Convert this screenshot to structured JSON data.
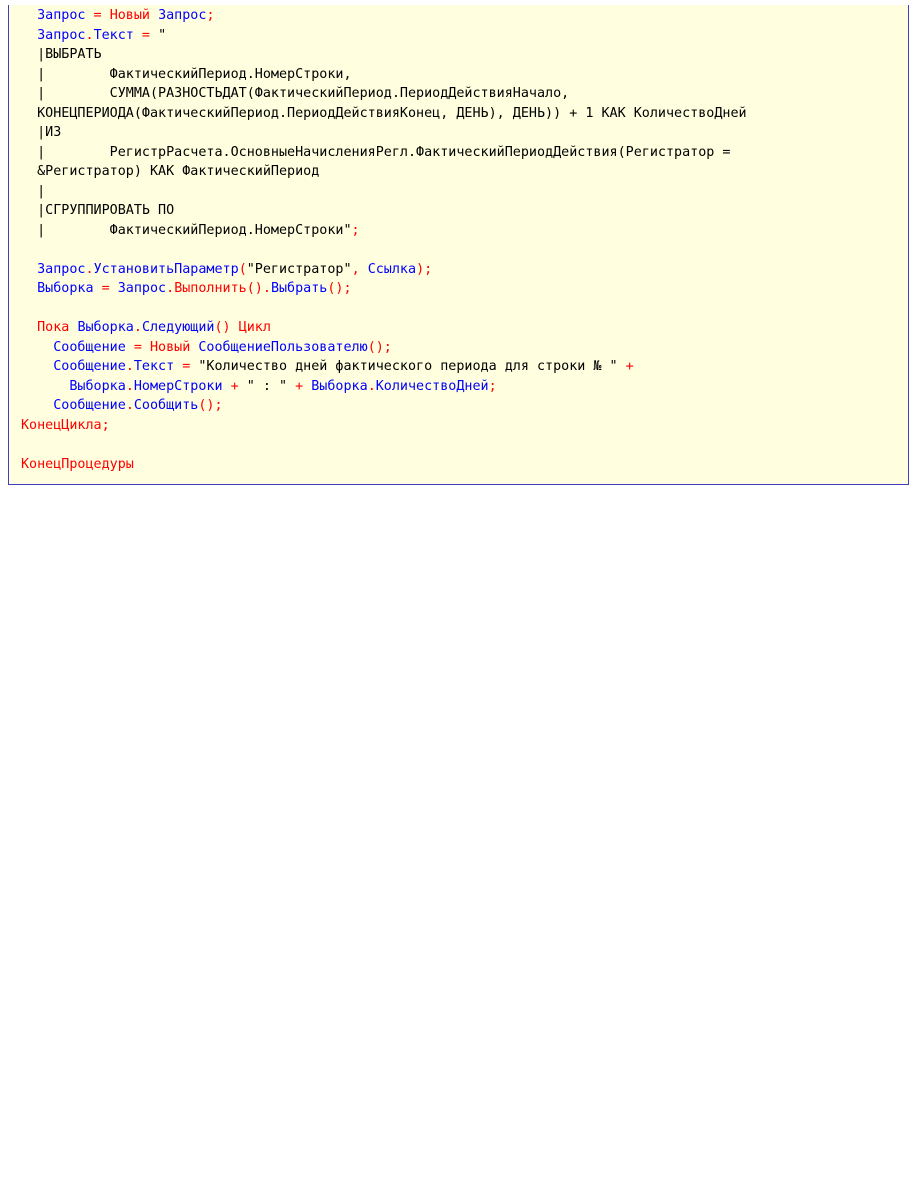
{
  "colors": {
    "background": "#ffffe0",
    "border": "#3f3fbf",
    "identifier": "#0000ff",
    "keyword": "#ff0000",
    "string": "#000000"
  },
  "code": {
    "lines": [
      [
        [
          "  ",
          "s"
        ],
        [
          "Запрос",
          "id"
        ],
        [
          " = ",
          "op"
        ],
        [
          "Новый",
          "kw"
        ],
        [
          " ",
          "s"
        ],
        [
          "Запрос",
          "id"
        ],
        [
          ";",
          "op"
        ]
      ],
      [
        [
          "  ",
          "s"
        ],
        [
          "Запрос",
          "id"
        ],
        [
          ".",
          "op"
        ],
        [
          "Текст",
          "id"
        ],
        [
          " = ",
          "op"
        ],
        [
          "\"",
          "str"
        ]
      ],
      [
        [
          "  |ВЫБРАТЬ",
          "str"
        ]
      ],
      [
        [
          "  |        ФактическийПериод.НомерСтроки,",
          "str"
        ]
      ],
      [
        [
          "  |        СУММА(РАЗНОСТЬДАТ(ФактическийПериод.ПериодДействияНачало,",
          "str"
        ]
      ],
      [
        [
          "  КОНЕЦПЕРИОДА(ФактическийПериод.ПериодДействияКонец, ДЕНЬ), ДЕНЬ)) + 1 КАК КоличествоДней",
          "str"
        ]
      ],
      [
        [
          "  |ИЗ",
          "str"
        ]
      ],
      [
        [
          "  |        РегистрРасчета.ОсновныеНачисленияРегл.ФактическийПериодДействия(Регистратор =",
          "str"
        ]
      ],
      [
        [
          "  &Регистратор) КАК ФактическийПериод",
          "str"
        ]
      ],
      [
        [
          "  |",
          "str"
        ]
      ],
      [
        [
          "  |СГРУППИРОВАТЬ ПО",
          "str"
        ]
      ],
      [
        [
          "  |        ФактическийПериод.НомерСтроки\"",
          "str"
        ],
        [
          ";",
          "op"
        ]
      ],
      [
        [
          "",
          "s"
        ]
      ],
      [
        [
          "  ",
          "s"
        ],
        [
          "Запрос",
          "id"
        ],
        [
          ".",
          "op"
        ],
        [
          "УстановитьПараметр",
          "id"
        ],
        [
          "(",
          "op"
        ],
        [
          "\"Регистратор\"",
          "str"
        ],
        [
          ", ",
          "op"
        ],
        [
          "Ссылка",
          "id"
        ],
        [
          ");",
          "op"
        ]
      ],
      [
        [
          "  ",
          "s"
        ],
        [
          "Выборка",
          "id"
        ],
        [
          " = ",
          "op"
        ],
        [
          "Запрос",
          "id"
        ],
        [
          ".",
          "op"
        ],
        [
          "Выполнить",
          "kw"
        ],
        [
          "().",
          "op"
        ],
        [
          "Выбрать",
          "id"
        ],
        [
          "();",
          "op"
        ]
      ],
      [
        [
          "",
          "s"
        ]
      ],
      [
        [
          "  ",
          "s"
        ],
        [
          "Пока",
          "kw"
        ],
        [
          " ",
          "s"
        ],
        [
          "Выборка",
          "id"
        ],
        [
          ".",
          "op"
        ],
        [
          "Следующий",
          "id"
        ],
        [
          "() ",
          "op"
        ],
        [
          "Цикл",
          "kw"
        ]
      ],
      [
        [
          "    ",
          "s"
        ],
        [
          "Сообщение",
          "id"
        ],
        [
          " = ",
          "op"
        ],
        [
          "Новый",
          "kw"
        ],
        [
          " ",
          "s"
        ],
        [
          "СообщениеПользователю",
          "id"
        ],
        [
          "();",
          "op"
        ]
      ],
      [
        [
          "    ",
          "s"
        ],
        [
          "Сообщение",
          "id"
        ],
        [
          ".",
          "op"
        ],
        [
          "Текст",
          "id"
        ],
        [
          " = ",
          "op"
        ],
        [
          "\"Количество дней фактического периода для строки № \"",
          "str"
        ],
        [
          " +",
          "op"
        ]
      ],
      [
        [
          "      ",
          "s"
        ],
        [
          "Выборка",
          "id"
        ],
        [
          ".",
          "op"
        ],
        [
          "НомерСтроки",
          "id"
        ],
        [
          " + ",
          "op"
        ],
        [
          "\" : \"",
          "str"
        ],
        [
          " + ",
          "op"
        ],
        [
          "Выборка",
          "id"
        ],
        [
          ".",
          "op"
        ],
        [
          "КоличествоДней",
          "id"
        ],
        [
          ";",
          "op"
        ]
      ],
      [
        [
          "    ",
          "s"
        ],
        [
          "Сообщение",
          "id"
        ],
        [
          ".",
          "op"
        ],
        [
          "Сообщить",
          "id"
        ],
        [
          "();",
          "op"
        ]
      ],
      [
        [
          "КонецЦикла",
          "kw"
        ],
        [
          ";",
          "op"
        ]
      ],
      [
        [
          "",
          "s"
        ]
      ],
      [
        [
          "КонецПроцедуры",
          "kw"
        ]
      ]
    ]
  }
}
